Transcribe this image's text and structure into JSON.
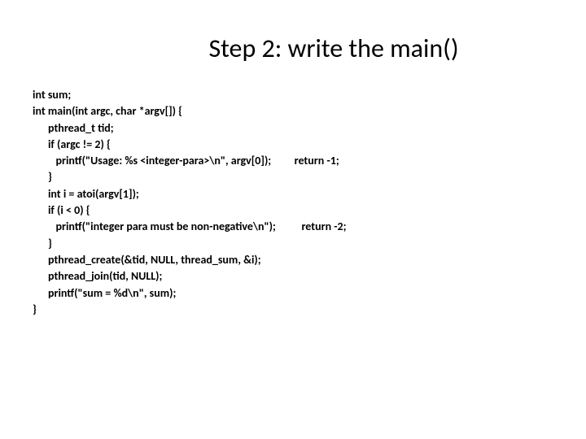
{
  "title": "Step 2: write the main()",
  "code": {
    "l1": "int sum;",
    "l2": "int main(int argc, char *argv[]) {",
    "l3": "      pthread_t tid;",
    "l4": "      if (argc != 2) {",
    "l5": "         printf(\"Usage: %s <integer-para>\\n\", argv[0]);         return -1;",
    "l6": "      }",
    "l7": "      int i = atoi(argv[1]);",
    "l8": "      if (i < 0) {",
    "l9": "         printf(\"integer para must be non-negative\\n\");          return -2;",
    "l10": "      }",
    "l11": "      pthread_create(&tid, NULL, thread_sum, &i);",
    "l12": "      pthread_join(tid, NULL);",
    "l13": "      printf(\"sum = %d\\n\", sum);",
    "l14": "}"
  }
}
